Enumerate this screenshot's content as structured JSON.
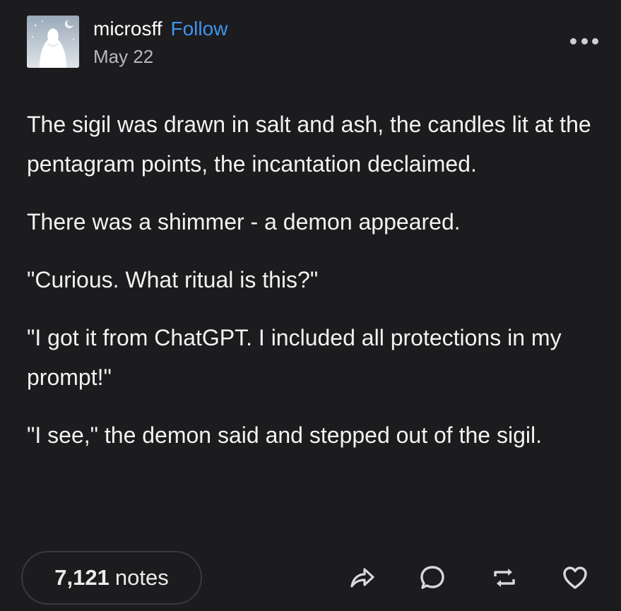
{
  "post": {
    "username": "microsff",
    "follow_label": "Follow",
    "date": "May 22",
    "paragraphs": [
      "The sigil was drawn in salt and ash, the candles lit at the pentagram points, the incantation declaimed.",
      "There was a shimmer - a demon appeared.",
      "\"Curious. What ritual is this?\"",
      "\"I got it from ChatGPT. I included all protections in my prompt!\"",
      "\"I see,\" the demon said and stepped out of the sigil."
    ],
    "notes_count": "7,121",
    "notes_label": "notes"
  },
  "icons": {
    "more": "more-dots-icon",
    "share": "share-arrow-icon",
    "reply": "comment-bubble-icon",
    "reblog": "reblog-icon",
    "like": "heart-icon"
  },
  "colors": {
    "background": "#1c1b1d",
    "text": "#f2f2f2",
    "follow": "#3e95f0",
    "meta": "#b8b8ba"
  }
}
